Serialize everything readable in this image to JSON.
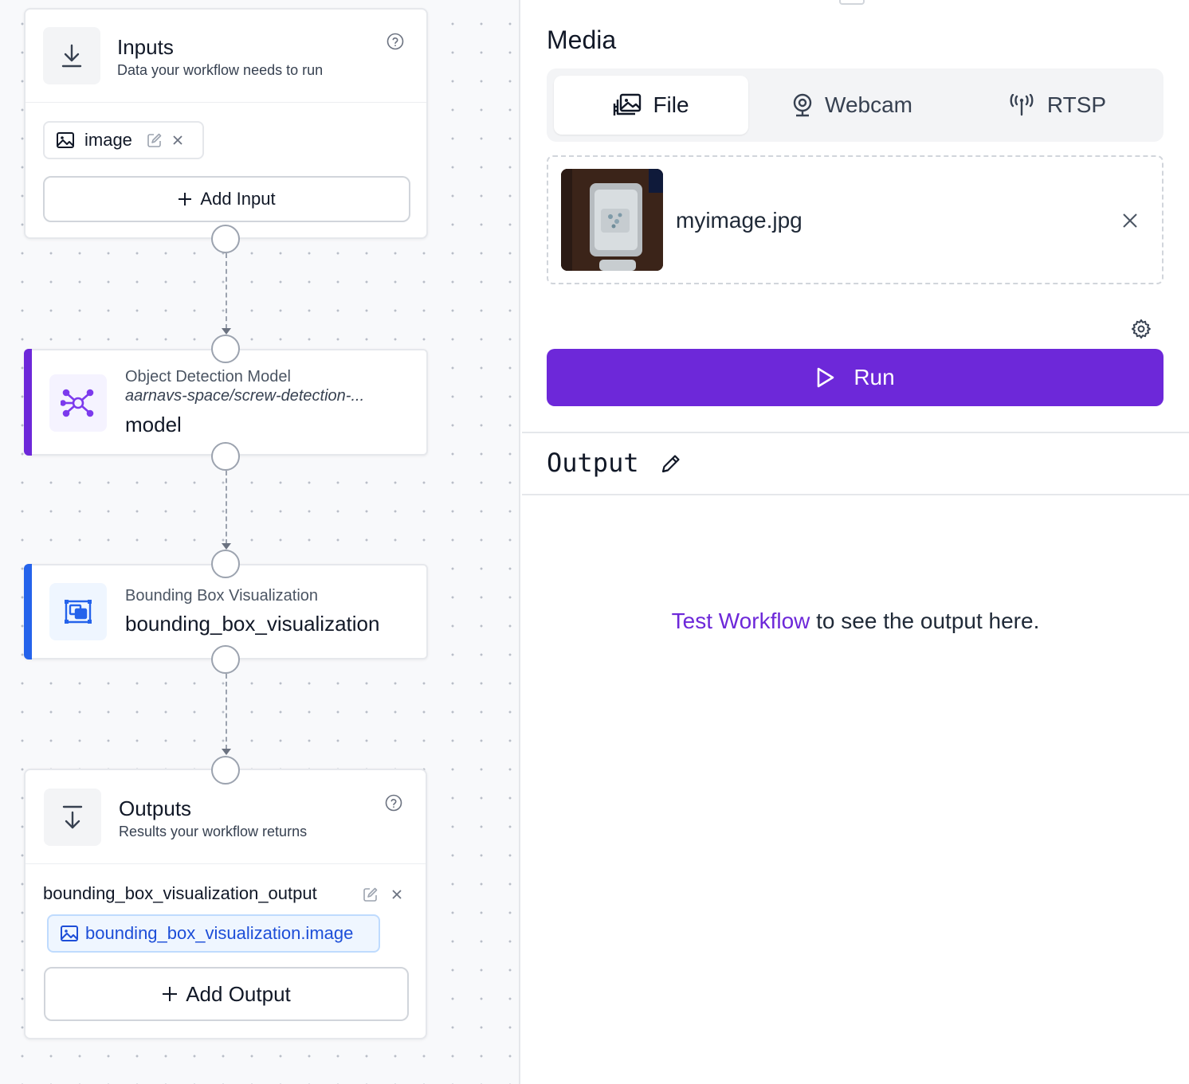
{
  "inputs_card": {
    "title": "Inputs",
    "subtitle": "Data your workflow needs to run",
    "input_chip_label": "image",
    "add_label": "Add Input"
  },
  "detection_block": {
    "type": "Object Detection Model",
    "model_id": "aarnavs-space/screw-detection-...",
    "name": "model",
    "accent": "#6d28d9"
  },
  "bbox_block": {
    "type": "Bounding Box Visualization",
    "name": "bounding_box_visualization",
    "accent": "#2563eb"
  },
  "outputs_card": {
    "title": "Outputs",
    "subtitle": "Results your workflow returns",
    "output_name": "bounding_box_visualization_output",
    "output_ref": "bounding_box_visualization.image",
    "add_label": "Add Output"
  },
  "media": {
    "title": "Media",
    "tabs": [
      {
        "label": "File",
        "icon": "images-icon",
        "active": true
      },
      {
        "label": "Webcam",
        "icon": "webcam-icon",
        "active": false
      },
      {
        "label": "RTSP",
        "icon": "antenna-icon",
        "active": false
      }
    ],
    "file_name": "myimage.jpg"
  },
  "run": {
    "label": "Run"
  },
  "output": {
    "title": "Output",
    "empty_link": "Test Workflow",
    "empty_text": " to see the output here."
  },
  "colors": {
    "primary": "#6d28d9",
    "link_blue": "#1d4ed8",
    "chip_blue_bg": "#eff6ff"
  }
}
